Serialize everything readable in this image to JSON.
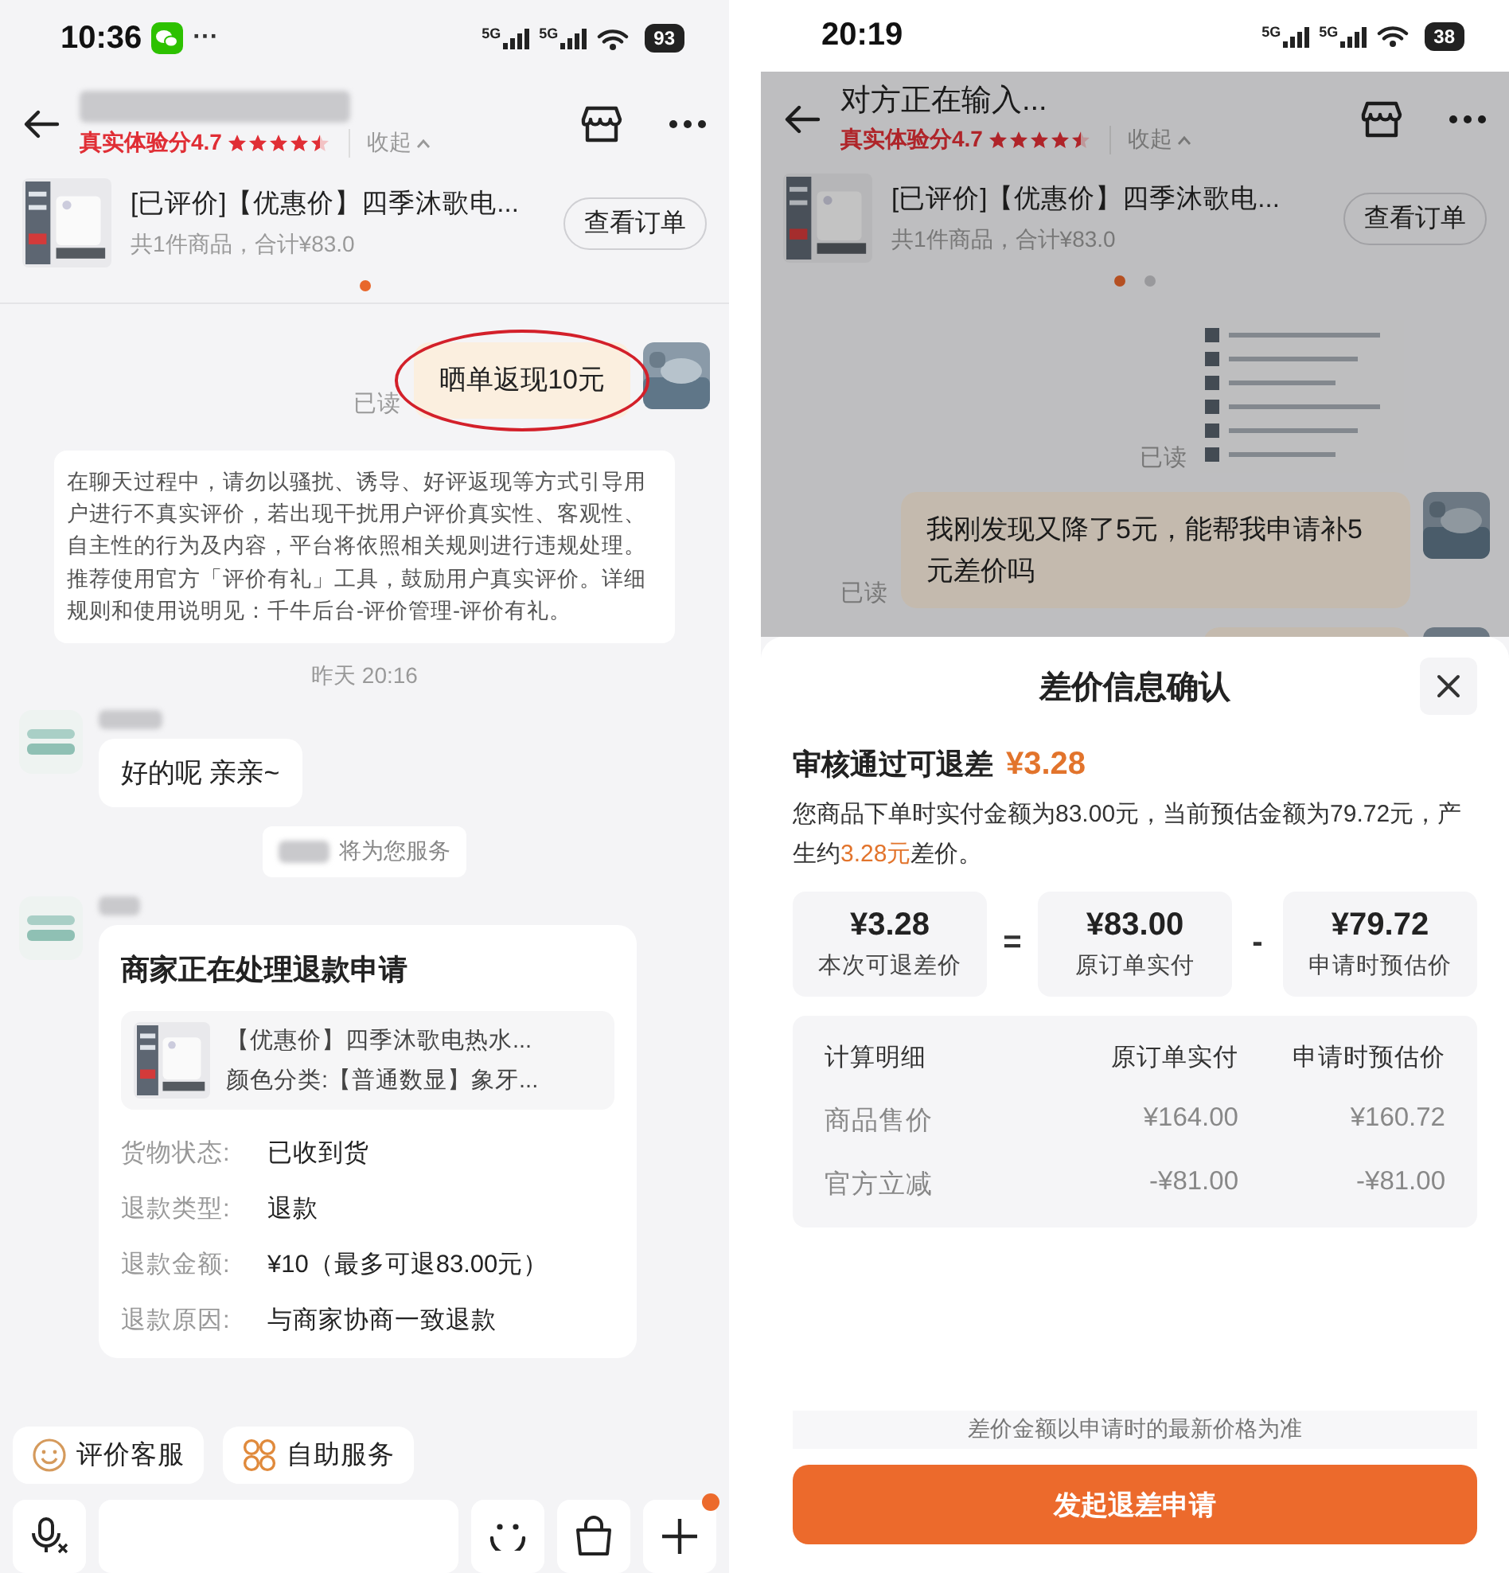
{
  "left_screen": {
    "status_bar": {
      "time": "10:36",
      "chat_notification": true,
      "overflow": "···",
      "signals": [
        {
          "label": "5G"
        },
        {
          "label": "5G"
        }
      ],
      "battery": "93"
    },
    "header": {
      "rating": "真实体验分4.7",
      "stars": 4.5,
      "collapse": "收起"
    },
    "order_card": {
      "title": "[已评价]【优惠价】四季沐歌电...",
      "summary": "共1件商品，合计¥83.0",
      "button": "查看订单",
      "pages": [
        {
          "selected": true
        }
      ]
    },
    "messages": [
      {
        "kind": "outgoing",
        "text": "晒单返现10元",
        "status": "已读",
        "circled": true
      },
      {
        "kind": "notice",
        "text": "在聊天过程中，请勿以骚扰、诱导、好评返现等方式引导用户进行不真实评价，若出现干扰用户评价真实性、客观性、自主性的行为及内容，平台将依照相关规则进行违规处理。推荐使用官方「评价有礼」工具，鼓励用户真实评价。详细规则和使用说明见：千牛后台-评价管理-评价有礼。"
      },
      {
        "kind": "time",
        "text": "昨天 20:16"
      },
      {
        "kind": "incoming",
        "text": "好的呢 亲亲~"
      },
      {
        "kind": "system",
        "text": "将为您服务"
      },
      {
        "kind": "refund_card",
        "title": "商家正在处理退款申请",
        "product": {
          "title": "【优惠价】四季沐歌电热水...",
          "variant": "颜色分类:【普通数显】象牙..."
        },
        "fields": [
          {
            "label": "货物状态:",
            "value": "已收到货"
          },
          {
            "label": "退款类型:",
            "value": "退款"
          },
          {
            "label": "退款金额:",
            "value": "¥10（最多可退83.00元）"
          },
          {
            "label": "退款原因:",
            "value": "与商家协商一致退款"
          }
        ]
      }
    ],
    "quick_actions": [
      {
        "kind": "rate",
        "label": "评价客服"
      },
      {
        "kind": "self_service",
        "label": "自助服务"
      }
    ],
    "input_bar": {
      "plus_badge": true
    }
  },
  "right_screen": {
    "status_bar": {
      "time": "20:19",
      "signals": [
        {
          "label": "5G"
        },
        {
          "label": "5G"
        }
      ],
      "battery": "38"
    },
    "header": {
      "title": "对方正在输入...",
      "rating": "真实体验分4.7",
      "stars": 4.5,
      "collapse": "收起"
    },
    "order_card": {
      "title": "[已评价]【优惠价】四季沐歌电...",
      "summary": "共1件商品，合计¥83.0",
      "button": "查看订单",
      "pages": [
        {
          "selected": true
        },
        {
          "selected": false
        }
      ]
    },
    "messages": [
      {
        "status": "已读"
      },
      {
        "kind": "outgoing",
        "text": "我刚发现又降了5元，能帮我申请补5元差价吗",
        "status": "已读",
        "circled": false
      },
      {
        "kind": "outgoing_cut"
      }
    ],
    "sheet": {
      "title": "差价信息确认",
      "headline": "审核通过可退差",
      "amount": "¥3.28",
      "description": [
        {
          "text": "您商品下单时实付金额为83.00元，当前预估金额为79.72元，产生约",
          "highlight": false
        },
        {
          "text": "3.28元",
          "highlight": true
        },
        {
          "text": "差价。",
          "highlight": false
        }
      ],
      "equation": [
        {
          "kind": "term",
          "value": "¥3.28",
          "label": "本次可退差价"
        },
        {
          "kind": "operator",
          "symbol": "="
        },
        {
          "kind": "term",
          "value": "¥83.00",
          "label": "原订单实付"
        },
        {
          "kind": "operator",
          "symbol": "-"
        },
        {
          "kind": "term",
          "value": "¥79.72",
          "label": "申请时预估价"
        }
      ],
      "breakdown": {
        "columns": [
          "计算明细",
          "原订单实付",
          "申请时预估价"
        ],
        "rows": [
          [
            "商品售价",
            "¥164.00",
            "¥160.72"
          ],
          [
            "官方立减",
            "-¥81.00",
            "-¥81.00"
          ]
        ]
      },
      "note": "差价金额以申请时的最新价格为准",
      "submit": "发起退差申请"
    }
  }
}
